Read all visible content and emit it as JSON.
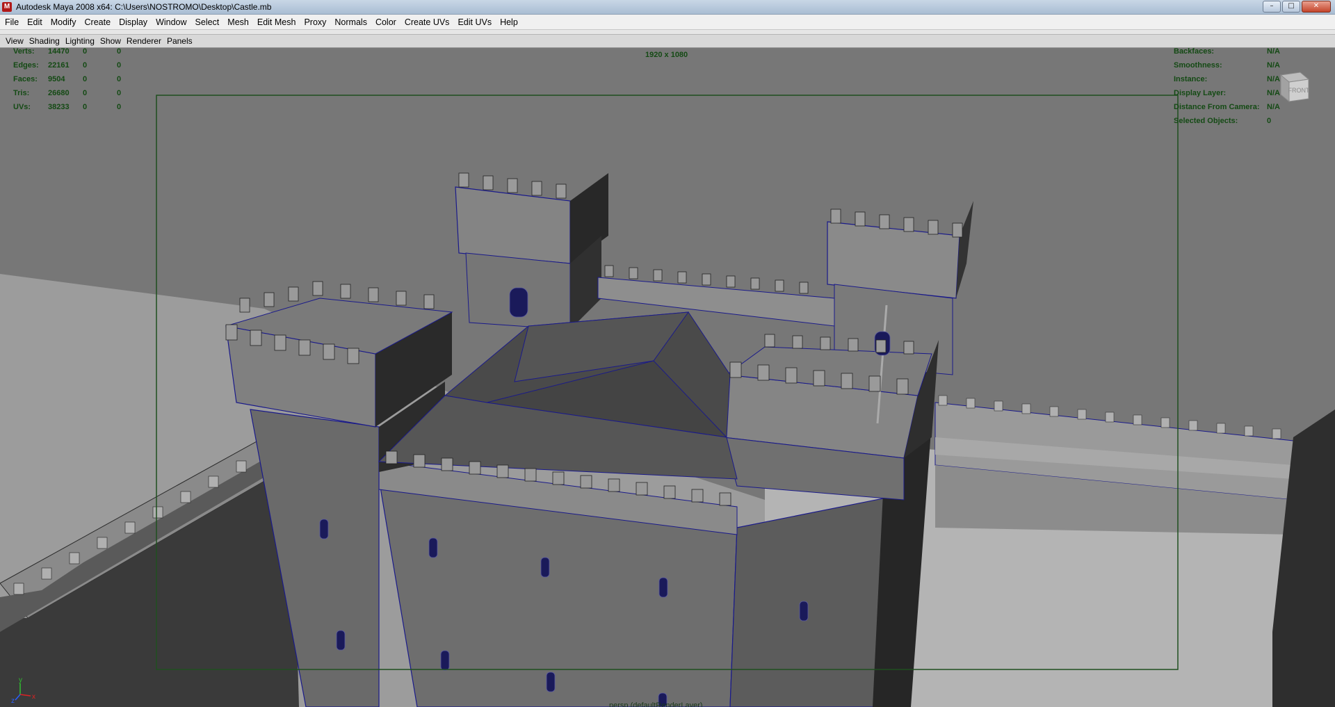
{
  "window": {
    "title": "Autodesk Maya 2008 x64: C:\\Users\\NOSTROMO\\Desktop\\Castle.mb",
    "app_icon_letter": "M",
    "controls": {
      "minimize": "–",
      "maximize": "□",
      "close": "✕"
    }
  },
  "menubar": {
    "items": [
      "File",
      "Edit",
      "Modify",
      "Create",
      "Display",
      "Window",
      "Select",
      "Mesh",
      "Edit Mesh",
      "Proxy",
      "Normals",
      "Color",
      "Create UVs",
      "Edit UVs",
      "Help"
    ]
  },
  "panel_menu": {
    "items": [
      "View",
      "Shading",
      "Lighting",
      "Show",
      "Renderer",
      "Panels"
    ]
  },
  "viewport": {
    "resolution_gate": "1920 x 1080",
    "bottom_camera_label": "persp (defaultRenderLayer)",
    "viewcube_face": "FRONT",
    "poly_count": {
      "rows": [
        {
          "label": "Verts:",
          "values": [
            "14470",
            "0",
            "0"
          ]
        },
        {
          "label": "Edges:",
          "values": [
            "22161",
            "0",
            "0"
          ]
        },
        {
          "label": "Faces:",
          "values": [
            "9504",
            "0",
            "0"
          ]
        },
        {
          "label": "Tris:",
          "values": [
            "26680",
            "0",
            "0"
          ]
        },
        {
          "label": "UVs:",
          "values": [
            "38233",
            "0",
            "0"
          ]
        }
      ]
    },
    "object_details": {
      "rows": [
        {
          "label": "Backfaces:",
          "value": "N/A"
        },
        {
          "label": "Smoothness:",
          "value": "N/A"
        },
        {
          "label": "Instance:",
          "value": "N/A"
        },
        {
          "label": "Display Layer:",
          "value": "N/A"
        },
        {
          "label": "Distance From Camera:",
          "value": "N/A"
        },
        {
          "label": "Selected Objects:",
          "value": "0"
        }
      ]
    },
    "axis": {
      "y": "y",
      "x": "x",
      "z": "z"
    },
    "colors": {
      "hud_text": "#144a14",
      "wireframe": "#1a1a8a",
      "resolution_gate": "#1f4f1f"
    }
  }
}
